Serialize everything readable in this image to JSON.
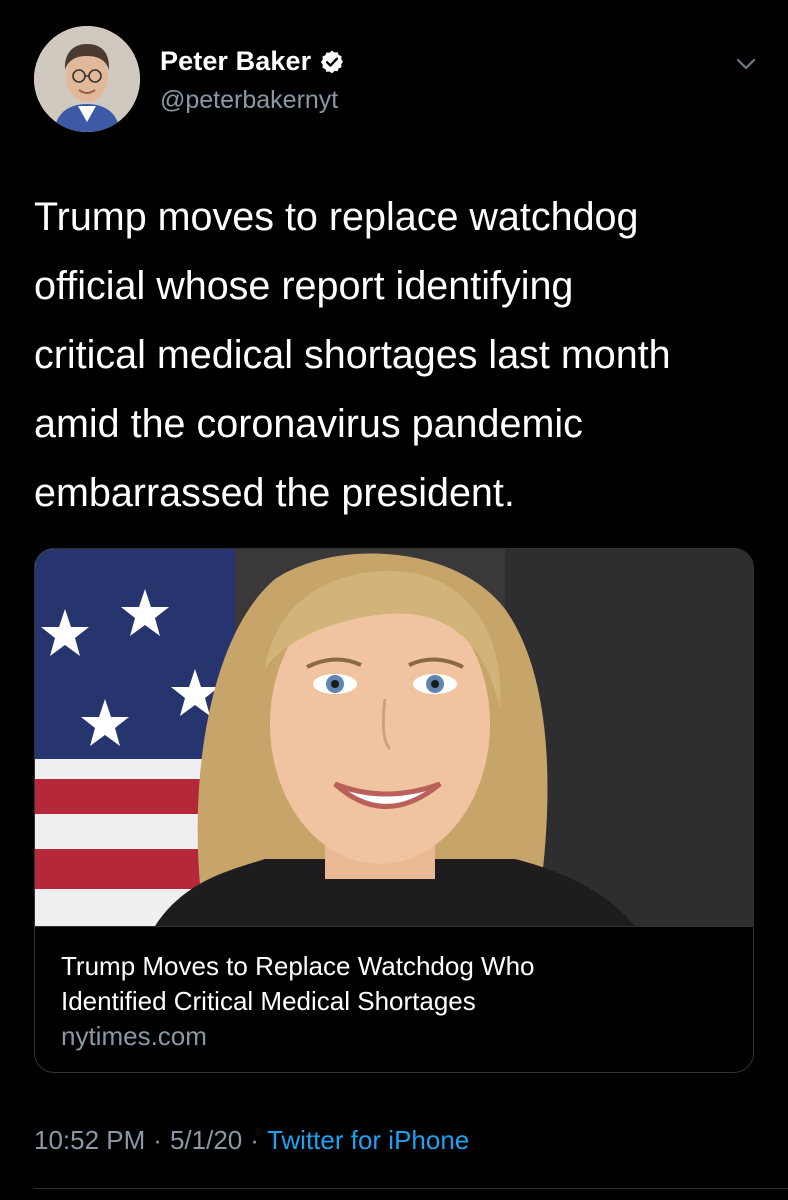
{
  "author": {
    "display_name": "Peter Baker",
    "handle": "@peterbakernyt",
    "verified": true
  },
  "tweet": {
    "text_lines": [
      "Trump moves to replace watchdog",
      "official whose report identifying",
      "critical medical shortages last month",
      "amid the coronavirus pandemic",
      "embarrassed the president."
    ]
  },
  "link_card": {
    "title_lines": [
      "Trump Moves to Replace Watchdog Who",
      "Identified Critical Medical Shortages"
    ],
    "domain": "nytimes.com"
  },
  "meta": {
    "time": "10:52 PM",
    "separator": "·",
    "date": "5/1/20",
    "source": "Twitter for iPhone"
  },
  "icons": {
    "verified": "verified-badge-icon",
    "more": "chevron-down-icon"
  },
  "colors": {
    "background": "#000000",
    "secondary_text": "#8899a6",
    "accent": "#1da1f2",
    "border": "#2f3336"
  }
}
